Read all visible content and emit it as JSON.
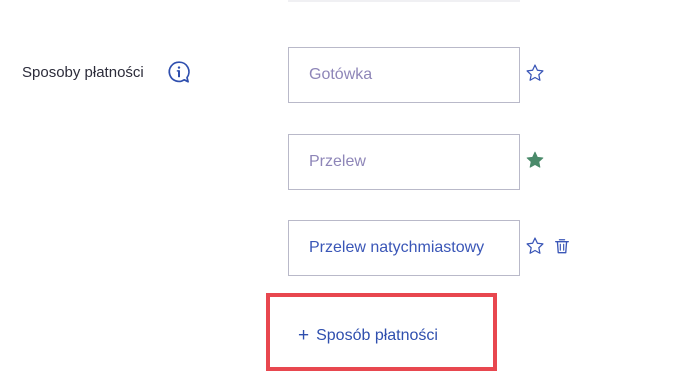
{
  "section": {
    "label": "Sposoby płatności"
  },
  "icons": {
    "info": "info-speech-bubble-icon",
    "favorite_outline": "star-outline-icon",
    "favorite_filled": "star-filled-icon",
    "delete": "trash-icon",
    "add": "plus-icon"
  },
  "colors": {
    "accent": "#3a56b7",
    "placeholder": "#8e86b8",
    "favorite_active": "#4a8a6a",
    "highlight_border": "#e8474f"
  },
  "payment_methods": [
    {
      "placeholder": "Gotówka",
      "value": "",
      "favorite": false,
      "deletable": false
    },
    {
      "placeholder": "Przelew",
      "value": "",
      "favorite": true,
      "deletable": false
    },
    {
      "placeholder": "",
      "value": "Przelew natychmiastowy",
      "favorite": false,
      "deletable": true
    }
  ],
  "add_button": {
    "plus": "+",
    "label": "Sposób płatności"
  }
}
